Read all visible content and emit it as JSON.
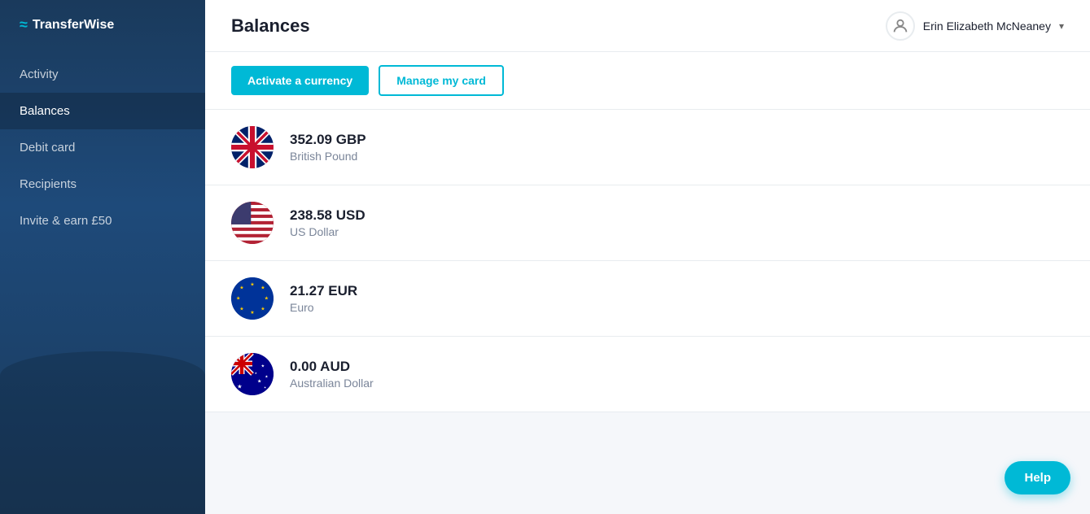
{
  "app": {
    "logo_text": "TransferWise",
    "logo_icon": "≈"
  },
  "sidebar": {
    "items": [
      {
        "id": "activity",
        "label": "Activity",
        "active": false
      },
      {
        "id": "balances",
        "label": "Balances",
        "active": true
      },
      {
        "id": "debit-card",
        "label": "Debit card",
        "active": false
      },
      {
        "id": "recipients",
        "label": "Recipients",
        "active": false
      },
      {
        "id": "invite",
        "label": "Invite & earn £50",
        "active": false
      }
    ]
  },
  "header": {
    "page_title": "Balances",
    "user_name": "Erin Elizabeth McNeaney",
    "dropdown_icon": "▾"
  },
  "action_bar": {
    "activate_button": "Activate a currency",
    "manage_button": "Manage my card"
  },
  "currencies": [
    {
      "code": "GBP",
      "amount": "352.09 GBP",
      "name": "British Pound",
      "flag_emoji": "🇬🇧"
    },
    {
      "code": "USD",
      "amount": "238.58 USD",
      "name": "US Dollar",
      "flag_emoji": "🇺🇸"
    },
    {
      "code": "EUR",
      "amount": "21.27 EUR",
      "name": "Euro",
      "flag_emoji": "🇪🇺"
    },
    {
      "code": "AUD",
      "amount": "0.00 AUD",
      "name": "Australian Dollar",
      "flag_emoji": "🇦🇺"
    }
  ],
  "help_button": {
    "label": "Help"
  }
}
